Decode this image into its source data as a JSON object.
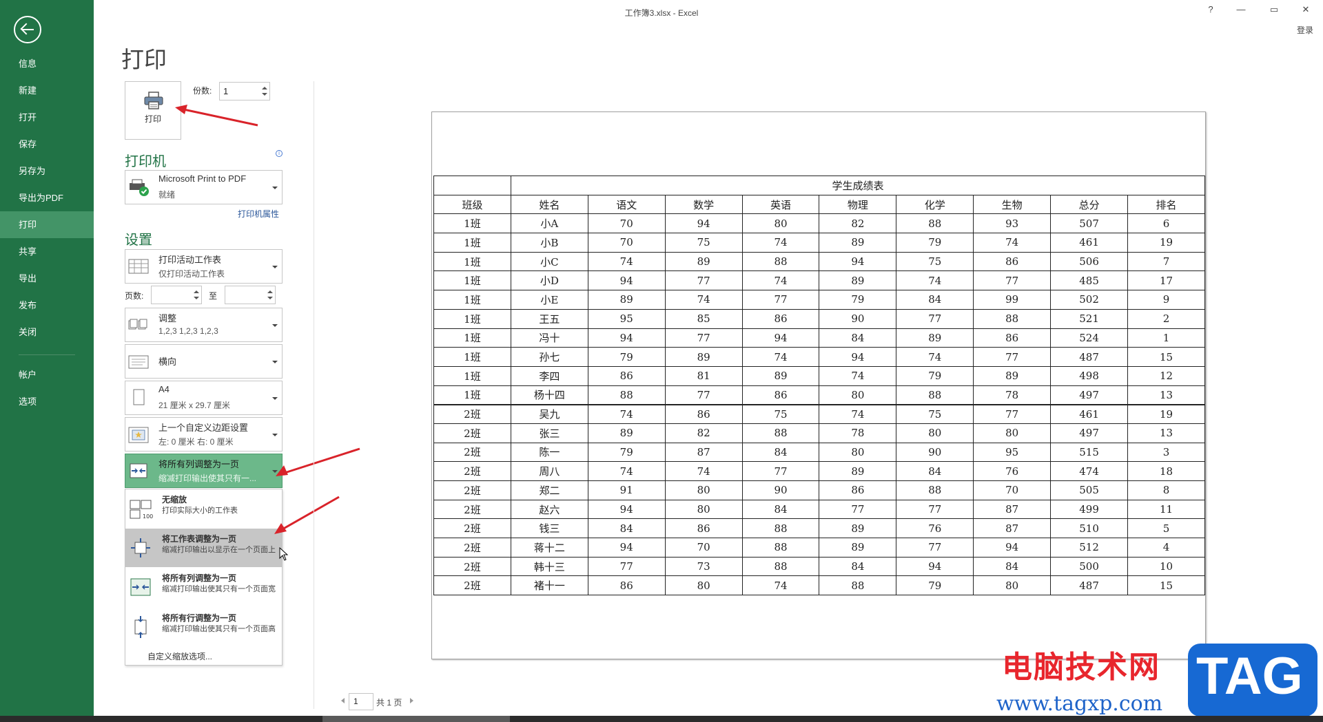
{
  "window": {
    "title": "工作簿3.xlsx - Excel",
    "help": "?",
    "minimize": "—",
    "maximize": "▭",
    "close": "✕",
    "signin": "登录"
  },
  "sidebar": {
    "items": [
      {
        "label": "信息"
      },
      {
        "label": "新建"
      },
      {
        "label": "打开"
      },
      {
        "label": "保存"
      },
      {
        "label": "另存为"
      },
      {
        "label": "导出为PDF"
      },
      {
        "label": "打印"
      },
      {
        "label": "共享"
      },
      {
        "label": "导出"
      },
      {
        "label": "发布"
      },
      {
        "label": "关闭"
      },
      {
        "label": "帐户"
      },
      {
        "label": "选项"
      }
    ],
    "active": "打印"
  },
  "print_panel": {
    "title": "打印",
    "print_button": "打印",
    "copies_label": "份数:",
    "copies_value": "1",
    "printer_heading": "打印机",
    "printer": {
      "name": "Microsoft Print to PDF",
      "status": "就绪"
    },
    "printer_properties": "打印机属性",
    "settings_heading": "设置",
    "settings": [
      {
        "line1": "打印活动工作表",
        "line2": "仅打印活动工作表"
      },
      {
        "line1": "调整",
        "line2": "1,2,3    1,2,3    1,2,3"
      },
      {
        "line1": "横向",
        "line2": ""
      },
      {
        "line1": "A4",
        "line2": "21 厘米 x 29.7 厘米"
      },
      {
        "line1": "上一个自定义边距设置",
        "line2": "左: 0 厘米    右: 0 厘米"
      },
      {
        "line1": "将所有列调整为一页",
        "line2": "缩减打印输出使其只有一..."
      }
    ],
    "pages_label": "页数:",
    "pages_to_label": "至",
    "scale_menu": [
      {
        "title": "无缩放",
        "desc": "打印实际大小的工作表"
      },
      {
        "title": "将工作表调整为一页",
        "desc": "缩减打印输出以显示在一个页面上"
      },
      {
        "title": "将所有列调整为一页",
        "desc": "缩减打印输出使其只有一个页面宽"
      },
      {
        "title": "将所有行调整为一页",
        "desc": "缩减打印输出使其只有一个页面高"
      }
    ],
    "custom_scale": "自定义缩放选项..."
  },
  "preview": {
    "table_title": "学生成绩表",
    "headers": [
      "班级",
      "姓名",
      "语文",
      "数学",
      "英语",
      "物理",
      "化学",
      "生物",
      "总分",
      "排名"
    ],
    "rows": [
      [
        "1班",
        "小A",
        "70",
        "94",
        "80",
        "82",
        "88",
        "93",
        "507",
        "6"
      ],
      [
        "1班",
        "小B",
        "70",
        "75",
        "74",
        "89",
        "79",
        "74",
        "461",
        "19"
      ],
      [
        "1班",
        "小C",
        "74",
        "89",
        "88",
        "94",
        "75",
        "86",
        "506",
        "7"
      ],
      [
        "1班",
        "小D",
        "94",
        "77",
        "74",
        "89",
        "74",
        "77",
        "485",
        "17"
      ],
      [
        "1班",
        "小E",
        "89",
        "74",
        "77",
        "79",
        "84",
        "99",
        "502",
        "9"
      ],
      [
        "1班",
        "王五",
        "95",
        "85",
        "86",
        "90",
        "77",
        "88",
        "521",
        "2"
      ],
      [
        "1班",
        "冯十",
        "94",
        "77",
        "94",
        "84",
        "89",
        "86",
        "524",
        "1"
      ],
      [
        "1班",
        "孙七",
        "79",
        "89",
        "74",
        "94",
        "74",
        "77",
        "487",
        "15"
      ],
      [
        "1班",
        "李四",
        "86",
        "81",
        "89",
        "74",
        "79",
        "89",
        "498",
        "12"
      ],
      [
        "1班",
        "杨十四",
        "88",
        "77",
        "86",
        "80",
        "88",
        "78",
        "497",
        "13"
      ],
      [
        "2班",
        "吴九",
        "74",
        "86",
        "75",
        "74",
        "75",
        "77",
        "461",
        "19"
      ],
      [
        "2班",
        "张三",
        "89",
        "82",
        "88",
        "78",
        "80",
        "80",
        "497",
        "13"
      ],
      [
        "2班",
        "陈一",
        "79",
        "87",
        "84",
        "80",
        "90",
        "95",
        "515",
        "3"
      ],
      [
        "2班",
        "周八",
        "74",
        "74",
        "77",
        "89",
        "84",
        "76",
        "474",
        "18"
      ],
      [
        "2班",
        "郑二",
        "91",
        "80",
        "90",
        "86",
        "88",
        "70",
        "505",
        "8"
      ],
      [
        "2班",
        "赵六",
        "94",
        "80",
        "84",
        "77",
        "77",
        "87",
        "499",
        "11"
      ],
      [
        "2班",
        "钱三",
        "84",
        "86",
        "88",
        "89",
        "76",
        "87",
        "510",
        "5"
      ],
      [
        "2班",
        "蒋十二",
        "94",
        "70",
        "88",
        "89",
        "77",
        "94",
        "512",
        "4"
      ],
      [
        "2班",
        "韩十三",
        "77",
        "73",
        "88",
        "84",
        "94",
        "84",
        "500",
        "10"
      ],
      [
        "2班",
        "褚十一",
        "86",
        "80",
        "74",
        "88",
        "79",
        "80",
        "487",
        "15"
      ]
    ],
    "page_current": "1",
    "page_total": "共 1 页"
  },
  "watermark": {
    "cn": "电脑技术网",
    "url": "www.tagxp.com",
    "tag": "TAG"
  },
  "colors": {
    "sidebar": "#217346",
    "sidebar_active": "#439467",
    "accent_green": "#217346",
    "arrow_red": "#d9232a"
  }
}
